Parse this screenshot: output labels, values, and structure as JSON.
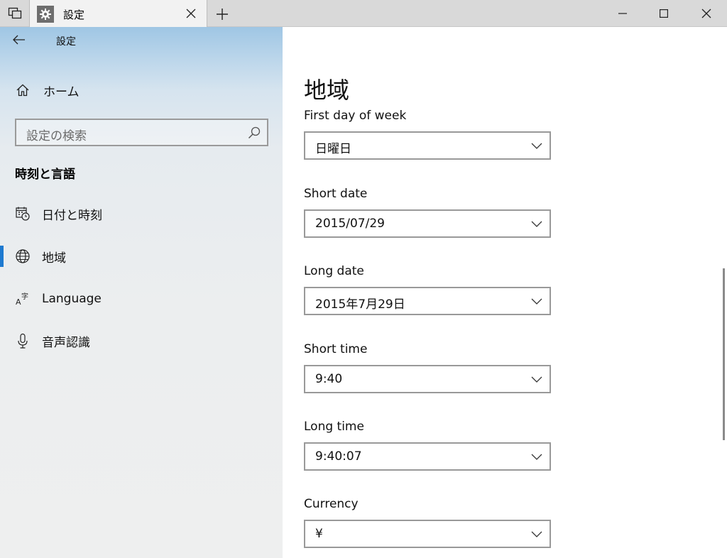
{
  "titlebar": {
    "tab_title": "設定"
  },
  "sidebar": {
    "title": "設定",
    "home_label": "ホーム",
    "search_placeholder": "設定の検索",
    "section_heading": "時刻と言語",
    "items": [
      {
        "label": "日付と時刻",
        "icon": "calendar-clock-icon"
      },
      {
        "label": "地域",
        "icon": "globe-icon",
        "selected": true
      },
      {
        "label": "Language",
        "icon": "language-icon"
      },
      {
        "label": "音声認識",
        "icon": "microphone-icon"
      }
    ]
  },
  "main": {
    "title": "地域",
    "fields": [
      {
        "label": "First day of week",
        "value": "日曜日"
      },
      {
        "label": "Short date",
        "value": "2015/07/29"
      },
      {
        "label": "Long date",
        "value": "2015年7月29日"
      },
      {
        "label": "Short time",
        "value": "9:40"
      },
      {
        "label": "Long time",
        "value": "9:40:07"
      },
      {
        "label": "Currency",
        "value": "¥"
      }
    ]
  },
  "colors": {
    "accent": "#1e7ad0",
    "sidebar_top": "#9fc6e4"
  }
}
